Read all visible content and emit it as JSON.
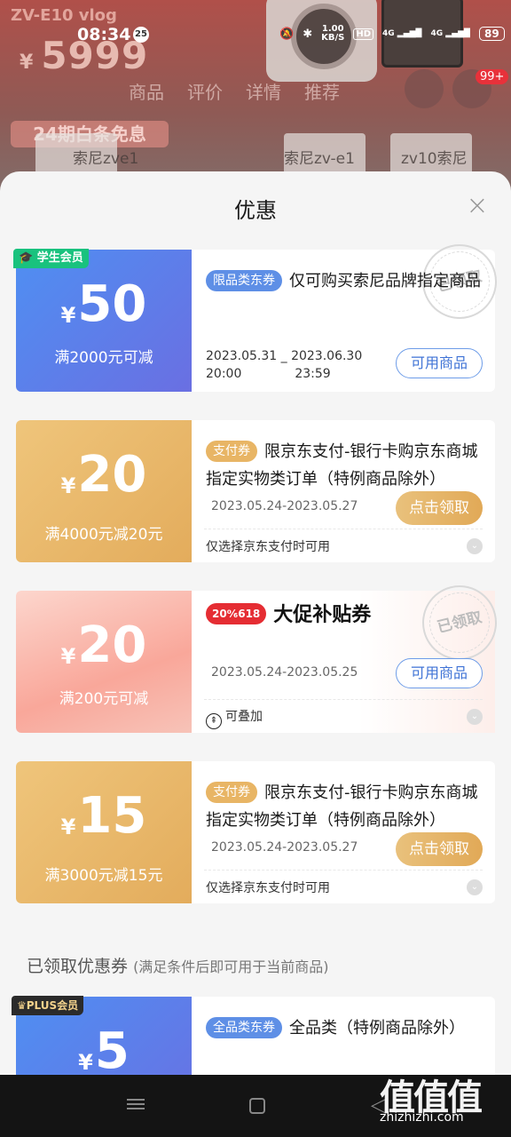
{
  "status_bar": {
    "time": "08:34",
    "notification_count": "25",
    "net_speed": "1.00",
    "net_unit": "KB/S",
    "hd": "HD",
    "sig1": "4G",
    "sig2": "4G",
    "battery": "89"
  },
  "background": {
    "price_prefix": "¥",
    "price": "5999",
    "tabs": [
      "商品",
      "评价",
      "详情",
      "推荐"
    ],
    "cart_badge": "99+",
    "promo": "24期白条免息",
    "thumbs": [
      "索尼zve1",
      "索尼zv-e1",
      "zv10索尼"
    ]
  },
  "sheet": {
    "title": "优惠",
    "close_icon": "close-icon"
  },
  "coupons": [
    {
      "member_tag": "学生会员",
      "currency": "¥",
      "amount": "50",
      "condition": "满2000元可减",
      "type_tag": "限品类东券",
      "desc": "仅可购买索尼品牌指定商品",
      "date_start": "2023.05.31",
      "date_start_time": "20:00",
      "date_sep": "_",
      "date_end": "2023.06.30",
      "date_end_time": "23:59",
      "button": "可用商品",
      "stamp": "已领取"
    },
    {
      "currency": "¥",
      "amount": "20",
      "condition": "满4000元减20元",
      "type_tag": "支付券",
      "desc": "限京东支付-银行卡购京东商城指定实物类订单（特例商品除外）",
      "date": "2023.05.24-2023.05.27",
      "button": "点击领取",
      "note": "仅选择京东支付时可用"
    },
    {
      "currency": "¥",
      "amount": "20",
      "condition": "满200元可减",
      "promo_logo": "20⁰⁄₆618",
      "title": "大促补贴券",
      "date": "2023.05.24-2023.05.25",
      "button": "可用商品",
      "note": "可叠加",
      "stamp": "已领取"
    },
    {
      "currency": "¥",
      "amount": "15",
      "condition": "满3000元减15元",
      "type_tag": "支付券",
      "desc": "限京东支付-银行卡购京东商城指定实物类订单（特例商品除外）",
      "date": "2023.05.24-2023.05.27",
      "button": "点击领取",
      "note": "仅选择京东支付时可用"
    }
  ],
  "claimed_section": {
    "title": "已领取优惠券",
    "subtitle": "(满足条件后即可用于当前商品)"
  },
  "claimed_coupon": {
    "member_tag": "PLUS会员",
    "currency": "¥",
    "amount": "5",
    "type_tag": "全品类东券",
    "desc": "全品类（特例商品除外）"
  },
  "watermark": {
    "main": "值值值",
    "sub": "zhizhizhi.com"
  },
  "colors": {
    "blue_coupon": "#4f8ff2",
    "gold_coupon": "#e3ac5c",
    "pink_coupon": "#f9a79a",
    "student_tag": "#19c27e",
    "promo_red": "#e52d33"
  }
}
